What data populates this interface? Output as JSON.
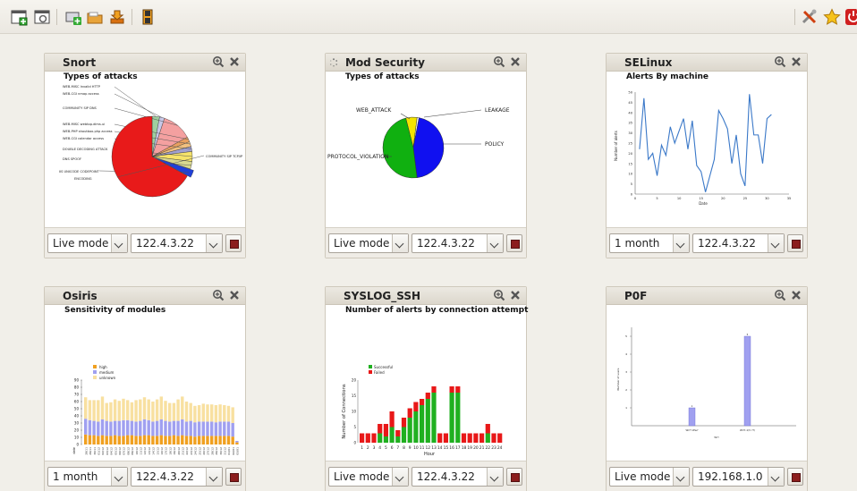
{
  "toolbar": {
    "left_icons": [
      "new-dashboard-icon",
      "dashboard-settings-icon",
      "add-panel-icon",
      "open-folder-icon",
      "download-icon",
      "save-icon"
    ],
    "right_icons": [
      "tools-icon",
      "favorite-star-icon",
      "power-icon"
    ]
  },
  "panels": [
    {
      "title": "Snort",
      "subtitle": "Types of attacks",
      "mode": "Live mode",
      "host": "122.4.3.22",
      "chart_data": {
        "type": "pie",
        "title": "Types of attacks",
        "labels": [
          "WEB-MISC Invalid HTTP",
          "WEB-CGI nmap access",
          "COMMUNITY SIP DNS",
          "WEB-MISC webtop.dims.ui",
          "WEB-PHP shoutbox.php access",
          "WEB-CGI calendar access",
          "DOUBLE DECODING ATTACK",
          "DNS SPOOF",
          "IIS UNICODE CODEPOINT ENCODING",
          "COMMUNITY SIP TCP/IP"
        ],
        "values": [
          3,
          2,
          12,
          2,
          2,
          2,
          4,
          3,
          3,
          67
        ],
        "colors": [
          "#9fcf9f",
          "#c8c8e8",
          "#f4a0a0",
          "#e8a060",
          "#f0c080",
          "#a0a0d0",
          "#f6e36a",
          "#d8d890",
          "#2040d8",
          "#e81a1a"
        ]
      }
    },
    {
      "title": "Mod Security",
      "subtitle": "Types of attacks",
      "mode": "Live mode",
      "host": "122.4.3.22",
      "chart_data": {
        "type": "pie",
        "title": "Types of attacks",
        "labels": [
          "WEB_ATTACK",
          "LEAKAGE",
          "POLICY",
          "PROTOCOL_VIOLATION"
        ],
        "values": [
          6,
          1,
          45,
          48
        ],
        "colors": [
          "#f4e400",
          "#ffffff",
          "#1010f0",
          "#10b010"
        ]
      }
    },
    {
      "title": "SELinux",
      "subtitle": "Alerts By machine",
      "mode": "1 month",
      "host": "122.4.3.22",
      "chart_data": {
        "type": "line",
        "title": "Alerts By machine",
        "xlabel": "Date",
        "ylabel": "Number of alerts",
        "xlim": [
          0,
          35
        ],
        "ylim": [
          0,
          50
        ],
        "xticks": [
          "0",
          "5",
          "10",
          "15",
          "20",
          "25",
          "30",
          "35"
        ],
        "yticks": [
          "0",
          "5",
          "10",
          "15",
          "20",
          "25",
          "30",
          "35",
          "40",
          "45",
          "50"
        ],
        "x": [
          1,
          2,
          3,
          4,
          5,
          6,
          7,
          8,
          9,
          10,
          11,
          12,
          13,
          14,
          15,
          16,
          17,
          18,
          19,
          20,
          21,
          22,
          23,
          24,
          25,
          26,
          27,
          28,
          29,
          30,
          31
        ],
        "y": [
          22,
          47,
          17,
          20,
          9,
          24,
          19,
          33,
          25,
          31,
          37,
          22,
          36,
          14,
          11,
          1,
          9,
          17,
          41,
          37,
          32,
          15,
          29,
          10,
          4,
          49,
          29,
          29,
          15,
          37,
          39
        ],
        "color": "#3a78c8"
      }
    },
    {
      "title": "Osiris",
      "subtitle": "Sensitivity of modules",
      "mode": "1 month",
      "host": "122.4.3.22",
      "chart_data": {
        "type": "bar",
        "title": "Sensitivity of modules",
        "legend": [
          "high",
          "medium",
          "unknown"
        ],
        "colors": [
          "#f0a020",
          "#a0a0f0",
          "#f8e0a0"
        ],
        "categories": [
          "28/11",
          "29/11",
          "30/11",
          "01/12",
          "02/12",
          "03/12",
          "04/12",
          "05/12",
          "06/12",
          "07/12",
          "08/12",
          "09/12",
          "10/12",
          "11/12",
          "12/12",
          "13/12",
          "14/12",
          "15/12",
          "16/12",
          "17/12",
          "18/12",
          "19/12",
          "20/12",
          "21/12",
          "22/12",
          "23/12",
          "24/12",
          "25/12",
          "26/12",
          "27/12",
          "28/12",
          "29/12",
          "30/12",
          "31/12",
          "01/01",
          "02/01",
          "03/01"
        ],
        "series": [
          {
            "name": "high",
            "values": [
              14,
              13,
              13,
              12,
              13,
              12,
              12,
              13,
              12,
              12,
              13,
              13,
              12,
              12,
              13,
              13,
              12,
              12,
              13,
              12,
              12,
              13,
              12,
              13,
              12,
              12,
              11,
              12,
              12,
              12,
              12,
              12,
              12,
              12,
              12,
              11,
              3
            ]
          },
          {
            "name": "medium",
            "values": [
              22,
              21,
              20,
              20,
              22,
              21,
              20,
              20,
              21,
              22,
              21,
              20,
              20,
              21,
              22,
              21,
              20,
              21,
              22,
              21,
              20,
              20,
              21,
              22,
              20,
              21,
              20,
              20,
              20,
              20,
              20,
              19,
              20,
              20,
              20,
              19,
              2
            ]
          },
          {
            "name": "unknown",
            "values": [
              30,
              28,
              29,
              30,
              32,
              25,
              27,
              30,
              28,
              30,
              28,
              26,
              30,
              30,
              31,
              29,
              28,
              30,
              32,
              28,
              26,
              25,
              30,
              32,
              28,
              25,
              23,
              23,
              25,
              24,
              24,
              24,
              24,
              23,
              22,
              22,
              0
            ]
          }
        ],
        "ylim": [
          0,
          90
        ],
        "yticks": [
          "0",
          "10",
          "20",
          "30",
          "40",
          "50",
          "60",
          "70",
          "80",
          "90"
        ],
        "xlabel": "date"
      }
    },
    {
      "title": "SYSLOG_SSH",
      "subtitle": "Number of alerts by connection attempt",
      "mode": "Live mode",
      "host": "122.4.3.22",
      "chart_data": {
        "type": "bar",
        "title": "Number of alerts by connection attempt",
        "legend": [
          "Successful",
          "Failed"
        ],
        "colors": [
          "#20b020",
          "#e81818"
        ],
        "categories": [
          "1",
          "2",
          "3",
          "4",
          "5",
          "6",
          "7",
          "8",
          "9",
          "10",
          "11",
          "12",
          "13",
          "14",
          "15",
          "16",
          "17",
          "18",
          "19",
          "20",
          "21",
          "22",
          "23",
          "24"
        ],
        "series": [
          {
            "name": "Successful",
            "values": [
              0,
              0,
              0,
              3,
              2,
              5,
              2,
              5,
              8,
              10,
              12,
              14,
              16,
              0,
              0,
              16,
              16,
              0,
              0,
              0,
              0,
              3,
              0,
              0
            ]
          },
          {
            "name": "Failed",
            "values": [
              3,
              3,
              3,
              3,
              4,
              5,
              2,
              3,
              3,
              3,
              2,
              2,
              2,
              3,
              3,
              2,
              2,
              3,
              3,
              3,
              3,
              3,
              3,
              3
            ]
          }
        ],
        "ylim": [
          0,
          20
        ],
        "yticks": [
          "0",
          "5",
          "10",
          "15",
          "20"
        ],
        "xlabel": "Hour",
        "ylabel": "Number of Connections"
      }
    },
    {
      "title": "P0F",
      "subtitle": "",
      "mode": "Live mode",
      "host": "192.168.1.0",
      "chart_data": {
        "type": "bar",
        "categories": [
          "Wi??  Ww?",
          "Wi??-1(V  ??/"
        ],
        "values": [
          1,
          5
        ],
        "color": "#a0a0f0",
        "ylim": [
          0,
          5.5
        ],
        "yticks": [
          "1",
          "2",
          "3",
          "4",
          "5"
        ],
        "xlabel": "W?!",
        "ylabel": "Number of users"
      }
    }
  ]
}
